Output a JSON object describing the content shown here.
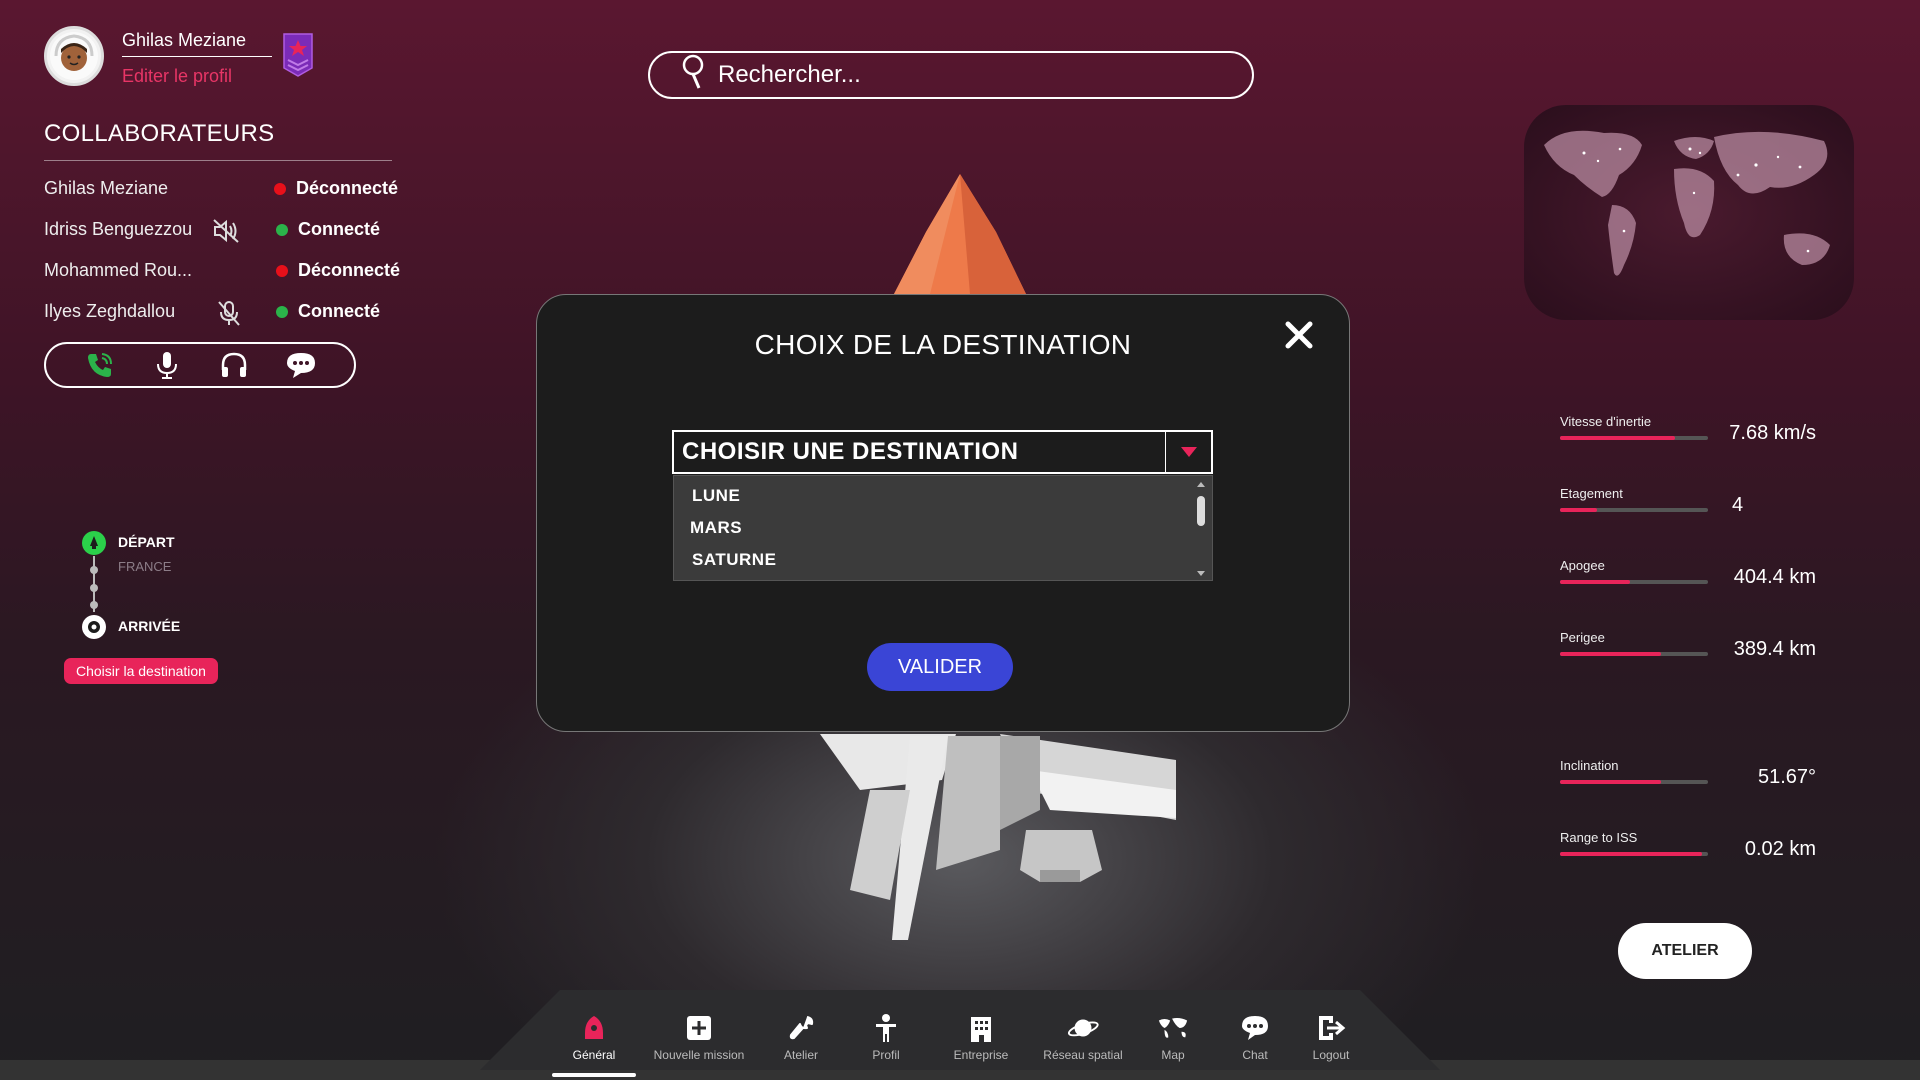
{
  "profile": {
    "name": "Ghilas Meziane",
    "edit_label": "Editer le profil"
  },
  "collaborators": {
    "title": "COLLABORATEURS",
    "rows": [
      {
        "name": "Ghilas Meziane",
        "status": "Déconnecté",
        "status_color": "#e8101a",
        "icon": ""
      },
      {
        "name": "Idriss Benguezzou",
        "status": "Connecté",
        "status_color": "#2bb34a",
        "icon": "speaker-muted-icon"
      },
      {
        "name": "Mohammed Rou...",
        "status": "Déconnecté",
        "status_color": "#e8101a",
        "icon": ""
      },
      {
        "name": "Ilyes Zeghdallou",
        "status": "Connecté",
        "status_color": "#2bb34a",
        "icon": "mic-muted-icon"
      }
    ]
  },
  "call_bar": [
    "phone-icon",
    "microphone-icon",
    "headphones-icon",
    "chat-bubble-icon"
  ],
  "route": {
    "departure_label": "DÉPART",
    "departure_place": "FRANCE",
    "arrival_label": "ARRIVÉE",
    "choose_label": "Choisir la destination"
  },
  "search": {
    "placeholder": "Rechercher..."
  },
  "stats": [
    {
      "label": "Vitesse d'inertie",
      "value": "7.68 km/s",
      "fill": 0.78
    },
    {
      "label": "Etagement",
      "value": "4",
      "fill": 0.25
    },
    {
      "label": "Apogee",
      "value": "404.4 km",
      "fill": 0.47
    },
    {
      "label": "Perigee",
      "value": "389.4 km",
      "fill": 0.68
    },
    {
      "label": "Inclination",
      "value": "51.67°",
      "fill": 0.68
    },
    {
      "label": "Range to ISS",
      "value": "0.02 km",
      "fill": 0.96
    }
  ],
  "atelier_button": "ATELIER",
  "modal": {
    "title": "CHOIX DE LA DESTINATION",
    "select_placeholder": "CHOISIR UNE DESTINATION",
    "options": [
      "LUNE",
      "MARS",
      "SATURNE"
    ],
    "valider": "VALIDER"
  },
  "nav": {
    "items": [
      {
        "label": "Général",
        "icon": "rocket-icon"
      },
      {
        "label": "Nouvelle mission",
        "icon": "plus-square-icon"
      },
      {
        "label": "Atelier",
        "icon": "wrench-icon"
      },
      {
        "label": "Profil",
        "icon": "person-icon"
      },
      {
        "label": "Entreprise",
        "icon": "building-icon"
      },
      {
        "label": "Réseau spatial",
        "icon": "planet-icon"
      },
      {
        "label": "Map",
        "icon": "map-icon"
      },
      {
        "label": "Chat",
        "icon": "chat-icon"
      },
      {
        "label": "Logout",
        "icon": "logout-icon"
      }
    ],
    "active_index": 0
  },
  "colors": {
    "accent": "#e8245a",
    "primary_button": "#3a45d6",
    "online": "#2bb34a",
    "offline": "#e8101a"
  }
}
